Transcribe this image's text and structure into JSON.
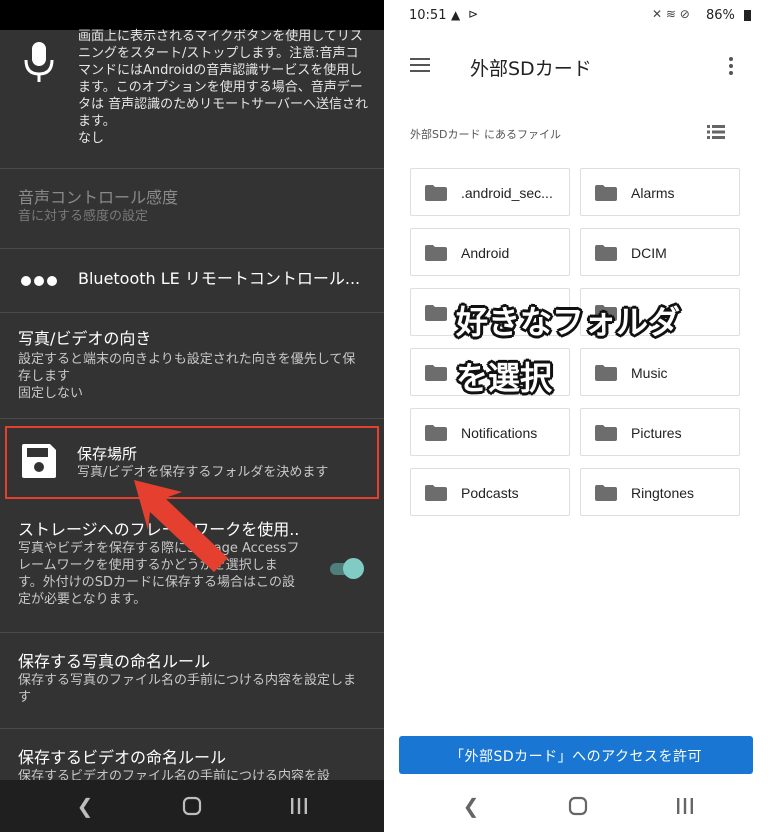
{
  "left": {
    "settings": [
      {
        "title": "",
        "subtitle": "画面上に表示されるマイクボタンを使用してリスニングをスタート/ストップします。注意:音声コマンドにはAndroidの音声認識サービスを使用します。このオプションを使用する場合、音声データは 音声認識のためリモートサーバーへ送信されます。",
        "value": "なし",
        "icon": "microphone-icon"
      },
      {
        "title": "音声コントロール感度",
        "subtitle": "音に対する感度の設定",
        "disabled": true
      },
      {
        "title": "Bluetooth LE リモートコントロール...",
        "icon": "more-dots-icon"
      },
      {
        "title": "写真/ビデオの向き",
        "subtitle": "設定すると端末の向きよりも設定された向きを優先して保存します",
        "value": "固定しない"
      },
      {
        "title": "保存場所",
        "subtitle": "写真/ビデオを保存するフォルダを決めます",
        "icon": "save-icon",
        "highlighted": true
      },
      {
        "title": "ストレージへのフレームワークを使用..",
        "subtitle": "写真やビデオを保存する際にStorage Accessフレームワークを使用するかどうかを選択します。外付けのSDカードに保存する場合はこの設定が必要となります。",
        "toggle": true
      },
      {
        "title": "保存する写真の命名ルール",
        "subtitle": "保存する写真のファイル名の手前につける内容を設定します"
      },
      {
        "title": "保存するビデオの命名ルール",
        "subtitle": "保存するビデオのファイル名の手前につける内容を設"
      }
    ],
    "accent_color": "#e5402f",
    "toggle_color": "#80cbc4"
  },
  "right": {
    "status": {
      "time": "10:51",
      "battery": "86%"
    },
    "header": {
      "title": "外部SDカード"
    },
    "section_label": "外部SDカード にあるファイル",
    "folders": [
      ".android_sec...",
      "Alarms",
      "Android",
      "DCIM",
      "",
      "",
      "",
      "Music",
      "Notifications",
      "Pictures",
      "Podcasts",
      "Ringtones"
    ],
    "overlay": {
      "line1": "好きなフォルダ",
      "line2": "を選択"
    },
    "access_button": "「外部SDカード」へのアクセスを許可",
    "accent_color": "#1976d2"
  }
}
